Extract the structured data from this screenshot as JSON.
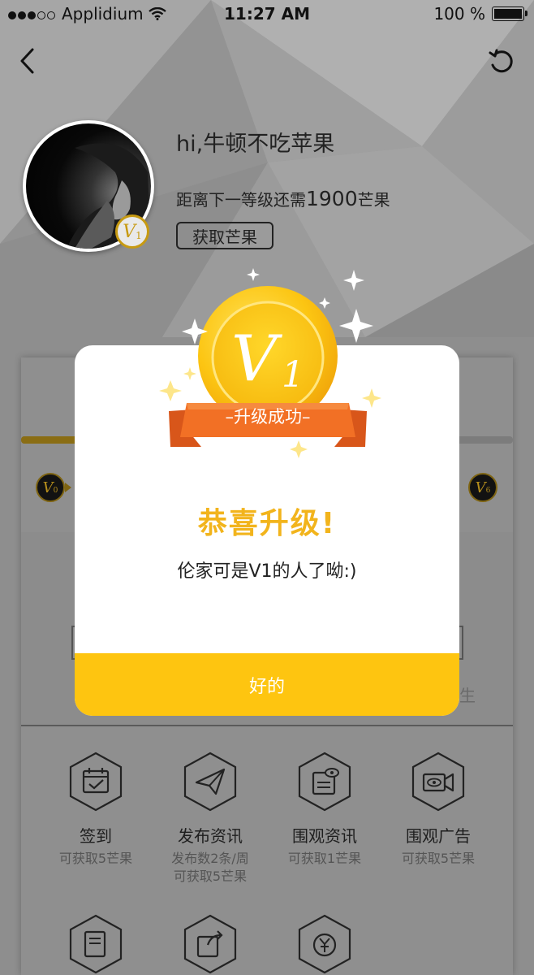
{
  "status_bar": {
    "carrier": "Applidium",
    "time": "11:27 AM",
    "battery": "100 %"
  },
  "profile": {
    "greeting": "hi,牛顿不吃苹果",
    "next_level_prefix": "距离下一等级还需",
    "next_level_amount": "1900",
    "next_level_suffix": "芒果",
    "get_mango_button": "获取芒果",
    "avatar_level": "V",
    "avatar_level_sub": "1"
  },
  "levels": {
    "start": {
      "letter": "V",
      "num": "0"
    },
    "end": {
      "letter": "V",
      "num": "6"
    }
  },
  "modal": {
    "medal_letter": "V",
    "medal_num": "1",
    "ribbon_text": "–升级成功–",
    "headline": "恭喜升级!",
    "message": "伦家可是V1的人了呦:)",
    "ok_button": "好的"
  },
  "background_peek_text": "生",
  "tasks": [
    {
      "title": "签到",
      "desc": "可获取5芒果",
      "icon": "calendar-check-icon"
    },
    {
      "title": "发布资讯",
      "desc": "发布数2条/周",
      "desc2": "可获取5芒果",
      "icon": "paper-plane-icon"
    },
    {
      "title": "围观资讯",
      "desc": "可获取1芒果",
      "icon": "news-eye-icon"
    },
    {
      "title": "围观广告",
      "desc": "可获取5芒果",
      "icon": "video-eye-icon"
    }
  ],
  "colors": {
    "accent": "#fec510",
    "headline": "#f2b41c",
    "ribbon": "#ef6a21",
    "overlay_gray": "#8f8f8f"
  }
}
